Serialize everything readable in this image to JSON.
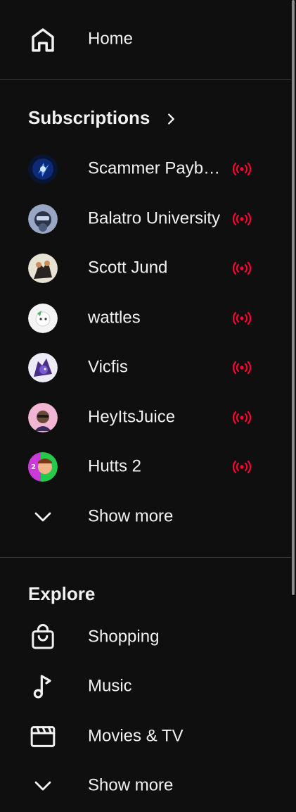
{
  "nav": {
    "home": {
      "label": "Home",
      "icon": "home-icon"
    }
  },
  "subscriptions": {
    "title": "Subscriptions",
    "channels": [
      {
        "name": "Scammer Payback",
        "display": "Scammer Payba…",
        "live": true
      },
      {
        "name": "Balatro University",
        "display": "Balatro University",
        "live": true
      },
      {
        "name": "Scott Jund",
        "display": "Scott Jund",
        "live": true
      },
      {
        "name": "wattles",
        "display": "wattles",
        "live": true
      },
      {
        "name": "Vicfis",
        "display": "Vicfis",
        "live": true
      },
      {
        "name": "HeyItsJuice",
        "display": "HeyItsJuice",
        "live": true
      },
      {
        "name": "Hutts 2",
        "display": "Hutts 2",
        "live": true
      }
    ],
    "show_more": "Show more"
  },
  "explore": {
    "title": "Explore",
    "items": [
      {
        "label": "Shopping",
        "icon": "shopping-bag-icon"
      },
      {
        "label": "Music",
        "icon": "music-note-icon"
      },
      {
        "label": "Movies & TV",
        "icon": "clapperboard-icon"
      }
    ],
    "show_more": "Show more"
  },
  "colors": {
    "background": "#0f0f0f",
    "text": "#f1f1f1",
    "live": "#ff0033",
    "divider": "#3a3a3a"
  }
}
